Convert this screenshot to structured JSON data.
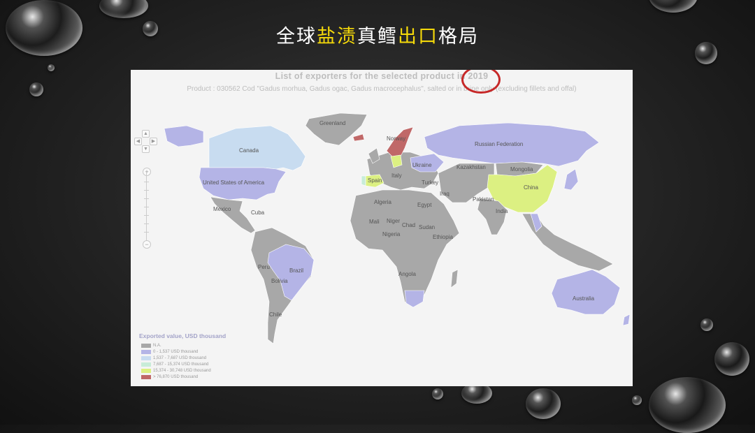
{
  "slide": {
    "title_parts": [
      {
        "text": "全球",
        "highlight": false
      },
      {
        "text": "盐渍",
        "highlight": true
      },
      {
        "text": "真鳕",
        "highlight": false
      },
      {
        "text": "出口",
        "highlight": true
      },
      {
        "text": "格局",
        "highlight": false
      }
    ],
    "highlight_color": "#f5d90a"
  },
  "map": {
    "title": "List of exporters for the selected product in 2019",
    "subtitle": "Product : 030562 Cod \"Gadus morhua, Gadus ogac, Gadus macrocephalus\", salted or in brine only (excluding fillets and offal)",
    "highlighted_year": "2019",
    "country_labels": {
      "greenland": "Greenland",
      "canada": "Canada",
      "usa": "United States of America",
      "mexico": "Mexico",
      "cuba": "Cuba",
      "norway": "Norway",
      "russia": "Russian Federation",
      "ukraine": "Ukraine",
      "kazakhstan": "Kazakhstan",
      "mongolia": "Mongolia",
      "china": "China",
      "spain": "Spain",
      "italy": "Italy",
      "turkey": "Turkey",
      "iraq": "Iraq",
      "pakistan": "Pakistan",
      "india": "India",
      "algeria": "Algeria",
      "egypt": "Egypt",
      "mali": "Mali",
      "niger": "Niger",
      "chad": "Chad",
      "sudan": "Sudan",
      "nigeria": "Nigeria",
      "ethiopia": "Ethiopia",
      "angola": "Angola",
      "peru": "Peru",
      "brazil": "Brazil",
      "bolivia": "Bolivia",
      "chile": "Chile",
      "australia": "Australia"
    },
    "legend": {
      "title": "Exported value, USD thousand",
      "items": [
        {
          "label": "N.A.",
          "color": "#a8a8a8"
        },
        {
          "label": "0 - 1,537 USD thousand",
          "color": "#b4b4e6"
        },
        {
          "label": "1,537 - 7,687 USD thousand",
          "color": "#c8dcf0"
        },
        {
          "label": "7,687 - 15,374 USD thousand",
          "color": "#c8ecd8"
        },
        {
          "label": "15,374 - 30,748 USD thousand",
          "color": "#dcf082"
        },
        {
          "label": "> 76,870 USD thousand",
          "color": "#c06868"
        }
      ]
    },
    "nav_controls": {
      "up": "▲",
      "down": "▼",
      "left": "◀",
      "right": "▶",
      "zoom_in": "+",
      "zoom_out": "−"
    }
  }
}
